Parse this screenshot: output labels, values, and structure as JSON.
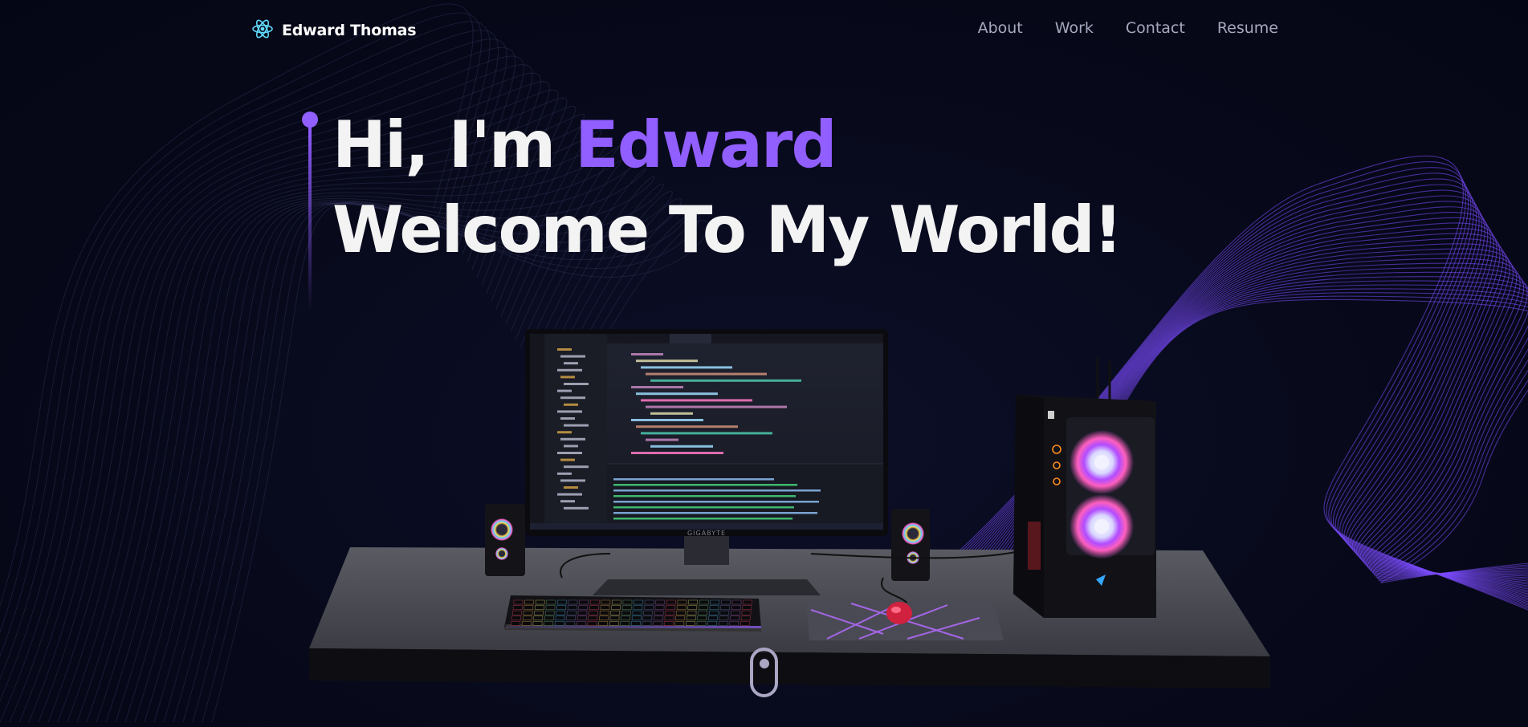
{
  "brand": {
    "name": "Edward Thomas",
    "logo_icon": "react-atom-icon"
  },
  "nav": {
    "links": [
      "About",
      "Work",
      "Contact",
      "Resume"
    ]
  },
  "hero": {
    "greeting": "Hi, I'm ",
    "name": "Edward",
    "tagline": "Welcome To My World!"
  },
  "scene": {
    "description_icon": "desktop-pc-3d-model",
    "monitor_brand": "GIGABYTE"
  },
  "scroll_indicator": {
    "icon": "mouse-scroll-icon"
  },
  "colors": {
    "background": "#07091a",
    "accent": "#915eff",
    "text": "#f3f3f3",
    "nav_text": "#a6a9bd"
  }
}
